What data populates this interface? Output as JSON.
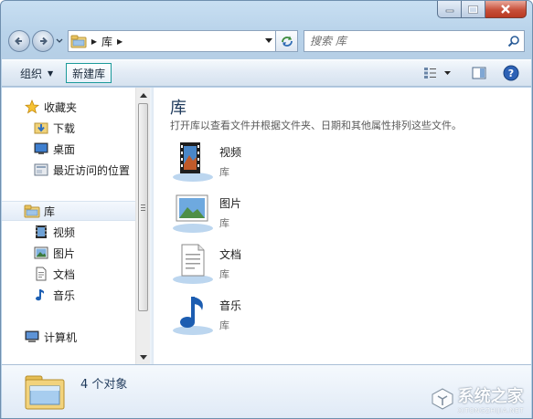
{
  "address": {
    "crumb": "库"
  },
  "search": {
    "placeholder": "搜索 库"
  },
  "toolbar": {
    "organize_label": "组织",
    "new_library_label": "新建库"
  },
  "sidebar": {
    "favorites": {
      "label": "收藏夹",
      "items": [
        {
          "label": "下载"
        },
        {
          "label": "桌面"
        },
        {
          "label": "最近访问的位置"
        }
      ]
    },
    "libraries": {
      "label": "库",
      "items": [
        {
          "label": "视频"
        },
        {
          "label": "图片"
        },
        {
          "label": "文档"
        },
        {
          "label": "音乐"
        }
      ]
    },
    "computer": {
      "label": "计算机"
    }
  },
  "main": {
    "title": "库",
    "description": "打开库以查看文件并根据文件夹、日期和其他属性排列这些文件。",
    "libraries": [
      {
        "name": "视频",
        "type": "库",
        "icon": "video-library-icon"
      },
      {
        "name": "图片",
        "type": "库",
        "icon": "pictures-library-icon"
      },
      {
        "name": "文档",
        "type": "库",
        "icon": "documents-library-icon"
      },
      {
        "name": "音乐",
        "type": "库",
        "icon": "music-library-icon"
      }
    ]
  },
  "details": {
    "count_text": "4 个对象"
  },
  "watermark": {
    "name": "系统之家",
    "url": "XITONGZHIJIA.NET"
  },
  "colors": {
    "title_text": "#1e395b",
    "selection": "#e3ecf7",
    "accent_border": "#1b9a9a"
  }
}
